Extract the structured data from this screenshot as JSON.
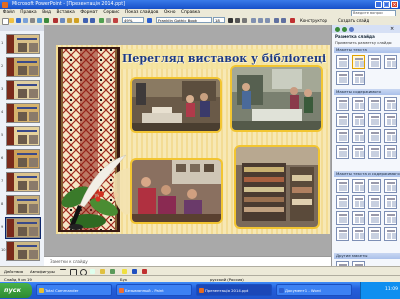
{
  "window": {
    "title": "Microsoft PowerPoint - [Презентація 2014.ppt]",
    "controls": [
      "_",
      "□",
      "×"
    ]
  },
  "menu": {
    "items": [
      "Файл",
      "Правка",
      "Вид",
      "Вставка",
      "Формат",
      "Сервис",
      "Показ слайдов",
      "Окно",
      "Справка"
    ],
    "help_placeholder": "Введите вопрос"
  },
  "toolbar": {
    "zoom": "49%",
    "font": "Franklin Gothic Book",
    "font_size": "18",
    "design_label": "Конструктор",
    "new_slide_label": "Создать слайд"
  },
  "thumbnails": [
    {
      "num": "1",
      "bg": "#d9c08a"
    },
    {
      "num": "2",
      "bg": "#c9a864"
    },
    {
      "num": "3",
      "bg": "#e0cfa0"
    },
    {
      "num": "4",
      "bg": "#d6b36e"
    },
    {
      "num": "5",
      "bg": "#e6d29c"
    },
    {
      "num": "6",
      "bg": "#cda15a"
    },
    {
      "num": "7",
      "bg": "#dcc38c"
    },
    {
      "num": "8",
      "bg": "#c8b07c"
    },
    {
      "num": "9",
      "bg": "#b8a070"
    },
    {
      "num": "10",
      "bg": "#cdb985"
    }
  ],
  "slide": {
    "title": "Перегляд виставок у бібліотеці",
    "photos": [
      "photo-1",
      "photo-2",
      "photo-3",
      "photo-4"
    ]
  },
  "notes": {
    "placeholder": "Заметки к слайду"
  },
  "task_pane": {
    "title": "Разметка слайда",
    "apply_label": "Применить разметку слайда:",
    "sections": [
      "Макеты текста",
      "Макеты содержимого",
      "Макеты текста и содержимого",
      "Другие макеты"
    ],
    "checkbox_label": "Показывать при вставке слайдов"
  },
  "drawbar": {
    "draw_label": "Действия",
    "autoshapes_label": "Автофигуры"
  },
  "status": {
    "slide": "Слайд 9 из 19",
    "design": "Бук",
    "language": "русский (Россия)"
  },
  "taskbar": {
    "start_label": "пуск",
    "tasks": [
      {
        "label": "Total Commander",
        "active": false,
        "color": "#e8c030"
      },
      {
        "label": "Безымянный - Paint",
        "active": false,
        "color": "#f07030"
      },
      {
        "label": "Презентація 2014.ppt",
        "active": true,
        "color": "#e46b20"
      },
      {
        "label": "Документ1 - Word",
        "active": false,
        "color": "#2b5fd0"
      }
    ],
    "time": "11:09"
  },
  "colors": {
    "title_blue": "#1e3a80",
    "frame_gold": "#f2c531",
    "xp_blue": "#245edb"
  }
}
